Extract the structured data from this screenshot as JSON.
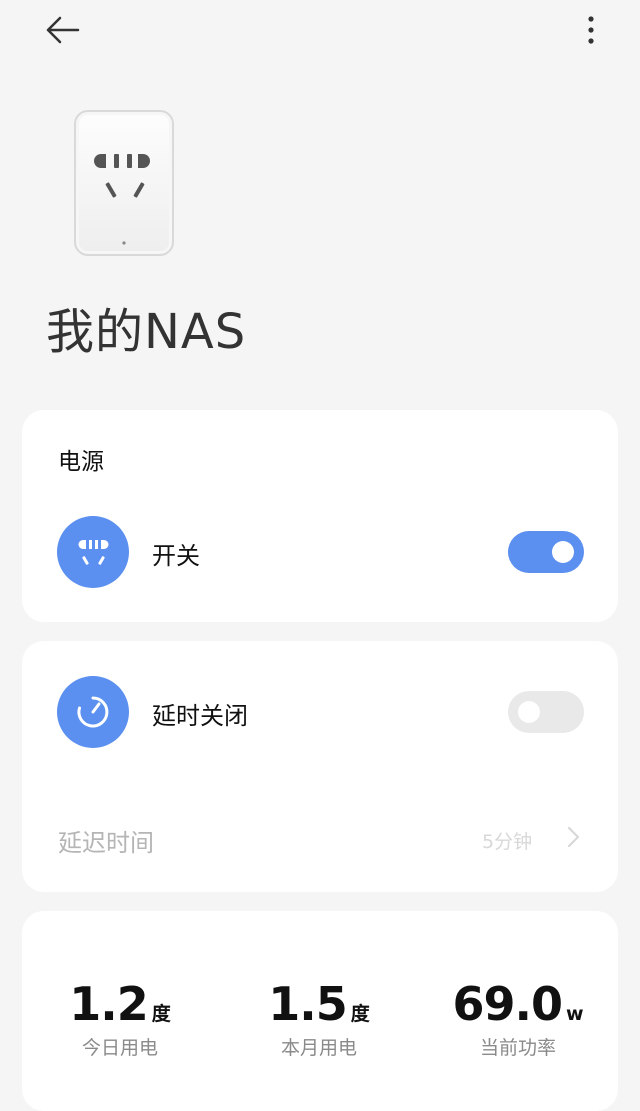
{
  "header": {
    "back_icon": "back-arrow-icon",
    "more_icon": "more-vertical-icon"
  },
  "device": {
    "name": "我的NAS",
    "image": "smart-plug-image"
  },
  "power_card": {
    "title": "电源",
    "switch_label": "开关",
    "switch_icon": "plug-icon",
    "switch_on": true
  },
  "timer_card": {
    "label": "延时关闭",
    "icon": "timer-icon",
    "enabled": false,
    "delay_label": "延迟时间",
    "delay_value": "5分钟"
  },
  "stats": [
    {
      "value": "1.2",
      "unit": "度",
      "label": "今日用电"
    },
    {
      "value": "1.5",
      "unit": "度",
      "label": "本月用电"
    },
    {
      "value": "69.0",
      "unit": "w",
      "label": "当前功率"
    }
  ],
  "colors": {
    "accent": "#5b8ff0",
    "background": "#f5f5f5",
    "card": "#ffffff"
  }
}
